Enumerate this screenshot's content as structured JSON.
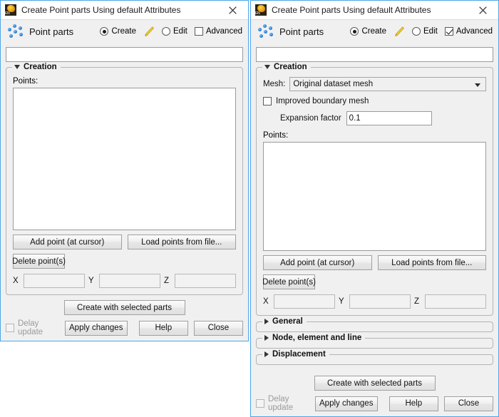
{
  "windows": [
    {
      "id": "left",
      "titlebar": {
        "title": "Create Point parts Using default Attributes",
        "icon": "app-icon",
        "icon_text": "EN",
        "close_label": "Close window"
      },
      "header": {
        "icon": "point-parts-icon",
        "label": "Point parts",
        "modes": {
          "create_label": "Create",
          "create_selected": true,
          "pencil_icon": "pencil-icon",
          "edit_label": "Edit",
          "edit_selected": false,
          "advanced_label": "Advanced",
          "advanced_checked": false
        }
      },
      "name_field": {
        "value": "",
        "placeholder": ""
      },
      "creation": {
        "title": "Creation",
        "expanded": true,
        "points_label": "Points:",
        "points": [],
        "add_point_label": "Add point (at cursor)",
        "load_points_label": "Load points from file...",
        "delete_points_label": "Delete point(s)",
        "coord_x_label": "X",
        "coord_y_label": "Y",
        "coord_z_label": "Z",
        "coord_x_value": "",
        "coord_y_value": "",
        "coord_z_value": ""
      },
      "collapsed_sections": [],
      "footer": {
        "create_label": "Create with selected parts",
        "delay_update_label": "Delay update",
        "delay_update_checked": false,
        "apply_label": "Apply changes",
        "help_label": "Help",
        "close_label": "Close"
      }
    },
    {
      "id": "right",
      "titlebar": {
        "title": "Create Point parts Using default Attributes",
        "icon": "app-icon",
        "icon_text": "EN",
        "close_label": "Close window"
      },
      "header": {
        "icon": "point-parts-icon",
        "label": "Point parts",
        "modes": {
          "create_label": "Create",
          "create_selected": true,
          "pencil_icon": "pencil-icon",
          "edit_label": "Edit",
          "edit_selected": false,
          "advanced_label": "Advanced",
          "advanced_checked": true
        }
      },
      "name_field": {
        "value": "",
        "placeholder": ""
      },
      "creation": {
        "title": "Creation",
        "expanded": true,
        "mesh_label": "Mesh:",
        "mesh_value": "Original dataset mesh",
        "improved_boundary_label": "Improved boundary mesh",
        "improved_boundary_checked": false,
        "expansion_factor_label": "Expansion factor",
        "expansion_factor_value": "0.1",
        "points_label": "Points:",
        "points": [],
        "add_point_label": "Add point (at cursor)",
        "load_points_label": "Load points from file...",
        "delete_points_label": "Delete point(s)",
        "coord_x_label": "X",
        "coord_y_label": "Y",
        "coord_z_label": "Z",
        "coord_x_value": "",
        "coord_y_value": "",
        "coord_z_value": ""
      },
      "collapsed_sections": [
        {
          "title": "General",
          "expanded": false
        },
        {
          "title": "Node, element and line",
          "expanded": false
        },
        {
          "title": "Displacement",
          "expanded": false
        }
      ],
      "footer": {
        "create_label": "Create with selected parts",
        "delay_update_label": "Delay update",
        "delay_update_checked": false,
        "apply_label": "Apply changes",
        "help_label": "Help",
        "close_label": "Close"
      }
    }
  ],
  "colors": {
    "window_border": "#4ca6e8",
    "dialog_bg": "#f0f0f0",
    "titlebar_bg": "#ffffff",
    "field_bg": "#ffffff",
    "disabled_text": "#9b9b9b",
    "accent_dot": "#2a7fd4",
    "pencil": "#f2cb2f"
  }
}
